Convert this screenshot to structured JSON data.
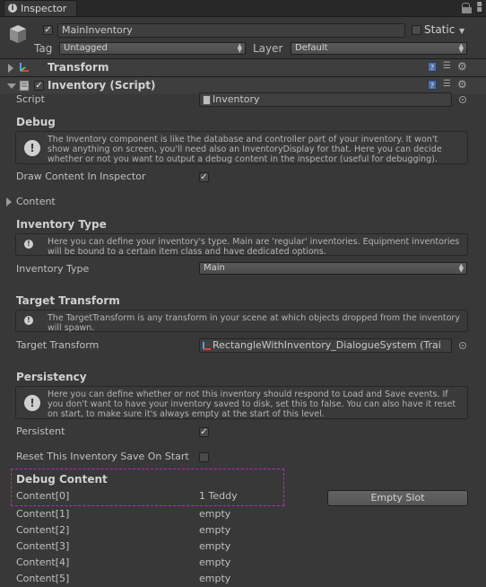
{
  "window": {
    "tab_title": "Inspector"
  },
  "object": {
    "name": "MainInventory",
    "active": true,
    "static_label": "Static",
    "static_checked": false,
    "tag_label": "Tag",
    "tag_value": "Untagged",
    "layer_label": "Layer",
    "layer_value": "Default"
  },
  "components": {
    "transform": {
      "title": "Transform"
    },
    "inventory": {
      "title": "Inventory (Script)",
      "enabled": true
    }
  },
  "script": {
    "label": "Script",
    "value": "Inventory"
  },
  "debug": {
    "heading": "Debug",
    "help": "The Inventory component is like the database and controller part of your inventory. It won't show anything on screen, you'll need also an InventoryDisplay for that. Here you can decide whether or not you want to output a debug content in the inspector (useful for debugging).",
    "draw_label": "Draw Content In Inspector",
    "draw_checked": true,
    "content_label": "Content"
  },
  "inventory_type": {
    "heading": "Inventory Type",
    "help": "Here you can define your inventory's type. Main are 'regular' inventories. Equipment inventories will be bound to a certain item class and have dedicated options.",
    "label": "Inventory Type",
    "value": "Main"
  },
  "target_transform": {
    "heading": "Target Transform",
    "help": "The TargetTransform is any transform in your scene at which objects dropped from the inventory will spawn.",
    "label": "Target Transform",
    "value": "RectangleWithInventory_DialogueSystem (Trai"
  },
  "persistency": {
    "heading": "Persistency",
    "help": "Here you can define whether or not this inventory should respond to Load and Save events. If you don't want to have your inventory saved to disk, set this to false. You can also have it reset on start, to make sure it's always empty at the start of this level.",
    "persistent_label": "Persistent",
    "persistent_checked": true,
    "reset_label": "Reset This Inventory Save On Start",
    "reset_checked": false
  },
  "debug_content": {
    "heading": "Debug Content",
    "empty_slot_button": "Empty Slot",
    "rows": [
      {
        "label": "Content[0]",
        "value": "1 Teddy"
      },
      {
        "label": "Content[1]",
        "value": "empty"
      },
      {
        "label": "Content[2]",
        "value": "empty"
      },
      {
        "label": "Content[3]",
        "value": "empty"
      },
      {
        "label": "Content[4]",
        "value": "empty"
      },
      {
        "label": "Content[5]",
        "value": "empty"
      }
    ]
  },
  "icons": {
    "info": "info-icon",
    "lock": "lock-icon",
    "menu": "menu-icon",
    "help": "help-icon",
    "settings": "gear-icon",
    "warning": "warning-icon"
  },
  "colors": {
    "background": "#383838",
    "highlight_outline": "#c424c4",
    "component_header": "#3e3e3e"
  }
}
